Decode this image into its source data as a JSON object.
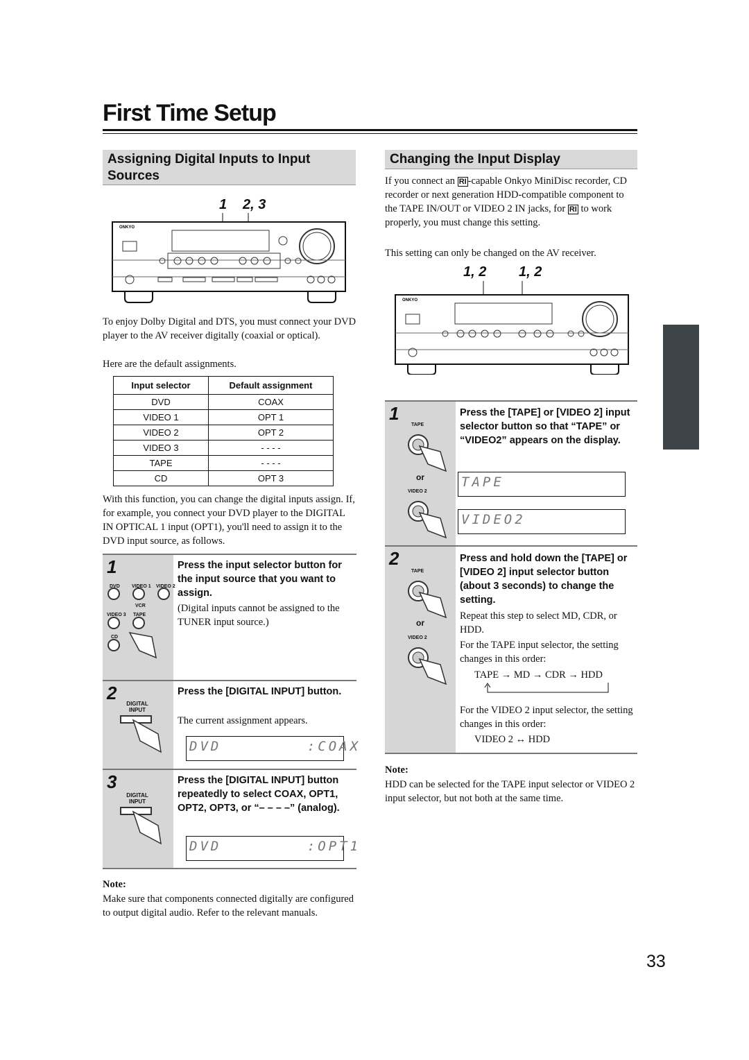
{
  "page": {
    "title": "First Time Setup",
    "number": "33"
  },
  "left": {
    "heading": "Assigning Digital Inputs to Input Sources",
    "callouts": {
      "a": "1",
      "b": "2, 3"
    },
    "receiver_brand": "ONKYO",
    "intro": "To enjoy Dolby Digital and DTS, you must connect your DVD player to the AV receiver digitally (coaxial or optical).",
    "defaults_text": "Here are the default assignments.",
    "table": {
      "headers": [
        "Input selector",
        "Default assignment"
      ],
      "rows": [
        [
          "DVD",
          "COAX"
        ],
        [
          "VIDEO 1",
          "OPT 1"
        ],
        [
          "VIDEO 2",
          "OPT 2"
        ],
        [
          "VIDEO 3",
          "- - - -"
        ],
        [
          "TAPE",
          "- - - -"
        ],
        [
          "CD",
          "OPT 3"
        ]
      ]
    },
    "body": "With this function, you can change the digital inputs assign. If, for example, you connect your DVD player to the DIGITAL IN OPTICAL 1 input (OPT1), you'll need to assign it to the DVD input source, as follows.",
    "steps": [
      {
        "num": "1",
        "head": "Press the input selector button for the input source that you want to assign.",
        "text": "(Digital inputs cannot be assigned to the TUNER input source.)",
        "buttons": [
          "DVD",
          "VIDEO 1",
          "VIDEO 2",
          "VCR",
          "VIDEO 3",
          "TAPE",
          "CD"
        ]
      },
      {
        "num": "2",
        "label": "DIGITAL INPUT",
        "head": "Press the [DIGITAL INPUT] button.",
        "text": "The current assignment appears.",
        "lcd": "DVD        :COAX"
      },
      {
        "num": "3",
        "label": "DIGITAL INPUT",
        "head": "Press the [DIGITAL INPUT] button repeatedly to select COAX, OPT1, OPT2, OPT3, or “– – – –” (analog).",
        "lcd": "DVD        :OPT1"
      }
    ],
    "note_head": "Note:",
    "note": "Make sure that components connected digitally are configured to output digital audio. Refer to the relevant manuals."
  },
  "right": {
    "heading": "Changing the Input Display",
    "intro_a": "If you connect an",
    "intro_b": "-capable Onkyo MiniDisc recorder, CD recorder or next generation HDD-compatible component to the TAPE IN/OUT or VIDEO 2 IN jacks, for",
    "intro_c": "to work properly, you must change this setting.",
    "intro2": "This setting can only be changed on the AV receiver.",
    "callouts": {
      "a": "1, 2",
      "b": "1, 2"
    },
    "steps": [
      {
        "num": "1",
        "label_top": "TAPE",
        "or": "or",
        "label_bottom": "VIDEO 2",
        "head": "Press the [TAPE] or [VIDEO 2] input selector button so that “TAPE” or “VIDEO2” appears on the display.",
        "lcd1": "TAPE",
        "lcd2": "VIDEO2"
      },
      {
        "num": "2",
        "label_top": "TAPE",
        "or": "or",
        "label_bottom": "VIDEO 2",
        "head": "Press and hold down the [TAPE] or [VIDEO 2] input selector button (about 3 seconds) to change the setting.",
        "text1": "Repeat this step to select MD, CDR, or HDD.",
        "text2": "For the TAPE input selector, the setting changes in this order:",
        "seq1": "TAPE → MD → CDR → HDD",
        "text3": "For the VIDEO 2 input selector, the setting changes in this order:",
        "seq2": "VIDEO 2 ↔ HDD"
      }
    ],
    "note_head": "Note:",
    "note": "HDD can be selected for the TAPE input selector or VIDEO 2 input selector, but not both at the same time."
  },
  "colors": {
    "section_bg": "#d8d8d8",
    "step_gutter": "#d6d6d6",
    "edge_tab": "#3d4548"
  }
}
